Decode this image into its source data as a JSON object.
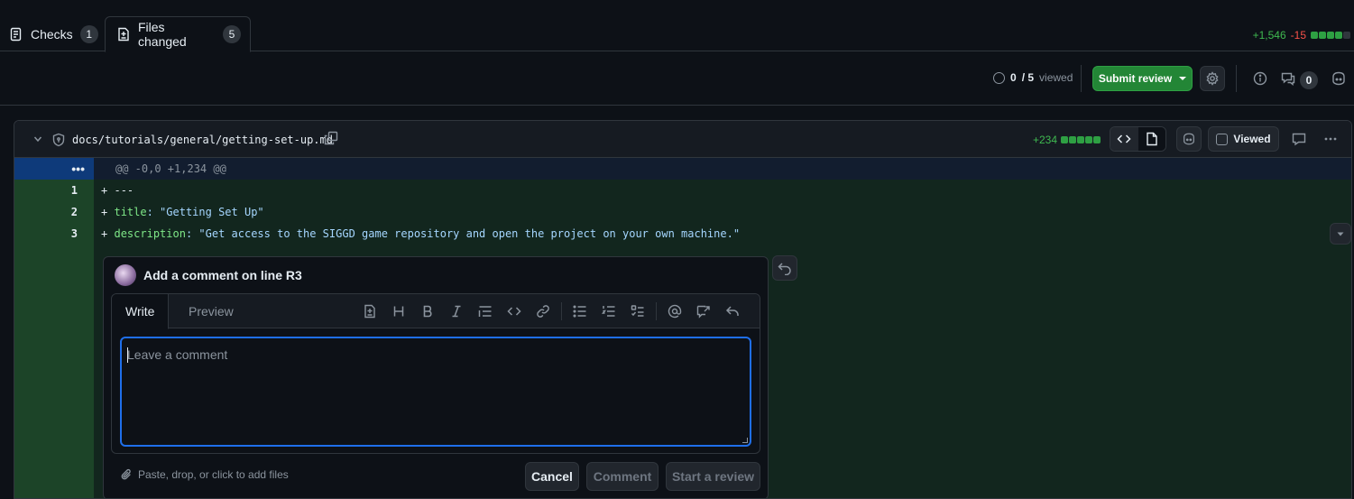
{
  "tabs": [
    {
      "label": "Checks",
      "count": "1",
      "icon": "checklist-icon"
    },
    {
      "label": "Files changed",
      "count": "5",
      "icon": "file-diff-icon"
    }
  ],
  "diffstat": {
    "additions": "+1,546",
    "deletions": "-15"
  },
  "toolbar": {
    "viewed_num": "0",
    "viewed_total": "/ 5",
    "viewed_label": "viewed",
    "submit_label": "Submit review",
    "comments_count": "0"
  },
  "file": {
    "path": "docs/tutorials/general/getting-set-up.md",
    "additions": "+234",
    "viewed_label": "Viewed"
  },
  "diff": {
    "hunk_marker": "•••",
    "hunk_header": "@@ -0,0 +1,234 @@",
    "lines": [
      {
        "num": "1",
        "sign": "+",
        "key": "---",
        "rest": ""
      },
      {
        "num": "2",
        "sign": "+",
        "key": "title",
        "rest": ": \"Getting Set Up\""
      },
      {
        "num": "3",
        "sign": "+",
        "key": "description",
        "rest": ": \"Get access to the SIGGD game repository and open the project on your own machine.\""
      }
    ]
  },
  "comment": {
    "title": "Add a comment on line R3",
    "tab_write": "Write",
    "tab_preview": "Preview",
    "placeholder": "Leave a comment",
    "attach_label": "Paste, drop, or click to add files",
    "cancel_label": "Cancel",
    "comment_label": "Comment",
    "review_label": "Start a review"
  },
  "colors": {
    "accent": "#1f6feb",
    "success": "#238636",
    "add_bg": "#12261e",
    "add_gutter": "#1c4428"
  }
}
